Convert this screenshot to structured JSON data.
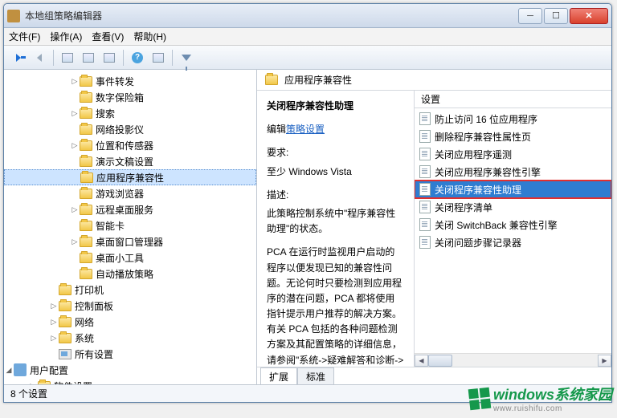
{
  "window": {
    "title": "本地组策略编辑器"
  },
  "menu": {
    "file": "文件(F)",
    "action": "操作(A)",
    "view": "查看(V)",
    "help": "帮助(H)"
  },
  "tree": {
    "items": [
      {
        "label": "事件转发",
        "icon": "folder",
        "indent": 3,
        "exp": "▷"
      },
      {
        "label": "数字保险箱",
        "icon": "folder",
        "indent": 3,
        "exp": ""
      },
      {
        "label": "搜索",
        "icon": "folder",
        "indent": 3,
        "exp": "▷"
      },
      {
        "label": "网络投影仪",
        "icon": "folder",
        "indent": 3,
        "exp": ""
      },
      {
        "label": "位置和传感器",
        "icon": "folder",
        "indent": 3,
        "exp": "▷"
      },
      {
        "label": "演示文稿设置",
        "icon": "folder",
        "indent": 3,
        "exp": ""
      },
      {
        "label": "应用程序兼容性",
        "icon": "folder",
        "indent": 3,
        "exp": "",
        "sel": true
      },
      {
        "label": "游戏浏览器",
        "icon": "folder",
        "indent": 3,
        "exp": ""
      },
      {
        "label": "远程桌面服务",
        "icon": "folder",
        "indent": 3,
        "exp": "▷"
      },
      {
        "label": "智能卡",
        "icon": "folder",
        "indent": 3,
        "exp": ""
      },
      {
        "label": "桌面窗口管理器",
        "icon": "folder",
        "indent": 3,
        "exp": "▷"
      },
      {
        "label": "桌面小工具",
        "icon": "folder",
        "indent": 3,
        "exp": ""
      },
      {
        "label": "自动播放策略",
        "icon": "folder",
        "indent": 3,
        "exp": ""
      },
      {
        "label": "打印机",
        "icon": "folder",
        "indent": 2,
        "exp": ""
      },
      {
        "label": "控制面板",
        "icon": "folder",
        "indent": 2,
        "exp": "▷"
      },
      {
        "label": "网络",
        "icon": "folder",
        "indent": 2,
        "exp": "▷"
      },
      {
        "label": "系统",
        "icon": "folder",
        "indent": 2,
        "exp": "▷"
      },
      {
        "label": "所有设置",
        "icon": "ctrl",
        "indent": 2,
        "exp": ""
      },
      {
        "label": "用户配置",
        "icon": "root",
        "indent": 0,
        "exp": "◢"
      },
      {
        "label": "软件设置",
        "icon": "folder",
        "indent": 1,
        "exp": "▷"
      }
    ]
  },
  "right": {
    "heading": "应用程序兼容性",
    "detail": {
      "title": "关闭程序兼容性助理",
      "edit_label": "编辑",
      "policy_link": "策略设置",
      "req_label": "要求:",
      "req_text": "至少 Windows Vista",
      "desc_label": "描述:",
      "desc1": "此策略控制系统中\"程序兼容性助理\"的状态。",
      "desc2": "PCA 在运行时监视用户启动的程序以便发现已知的兼容性问题。无论何时只要检测到应用程序的潜在问题，PCA 都将使用指针提示用户推荐的解决方案。有关 PCA 包括的各种问题检测方案及其配置策略的详细信息，请参阅\"系统->疑难解答和诊断->应用程序兼容性诊断\""
    },
    "settings": {
      "head": "设置",
      "items": [
        {
          "label": "防止访问 16 位应用程序"
        },
        {
          "label": "删除程序兼容性属性页"
        },
        {
          "label": "关闭应用程序遥测"
        },
        {
          "label": "关闭应用程序兼容性引擎"
        },
        {
          "label": "关闭程序兼容性助理",
          "sel": true,
          "hl": true
        },
        {
          "label": "关闭程序清单"
        },
        {
          "label": "关闭 SwitchBack 兼容性引擎"
        },
        {
          "label": "关闭问题步骤记录器"
        }
      ]
    },
    "tabs": {
      "extended": "扩展",
      "standard": "标准"
    }
  },
  "status": {
    "text": "8 个设置"
  },
  "watermark": {
    "text": "indows系统家园",
    "sub": "www.ruishifu.com"
  }
}
